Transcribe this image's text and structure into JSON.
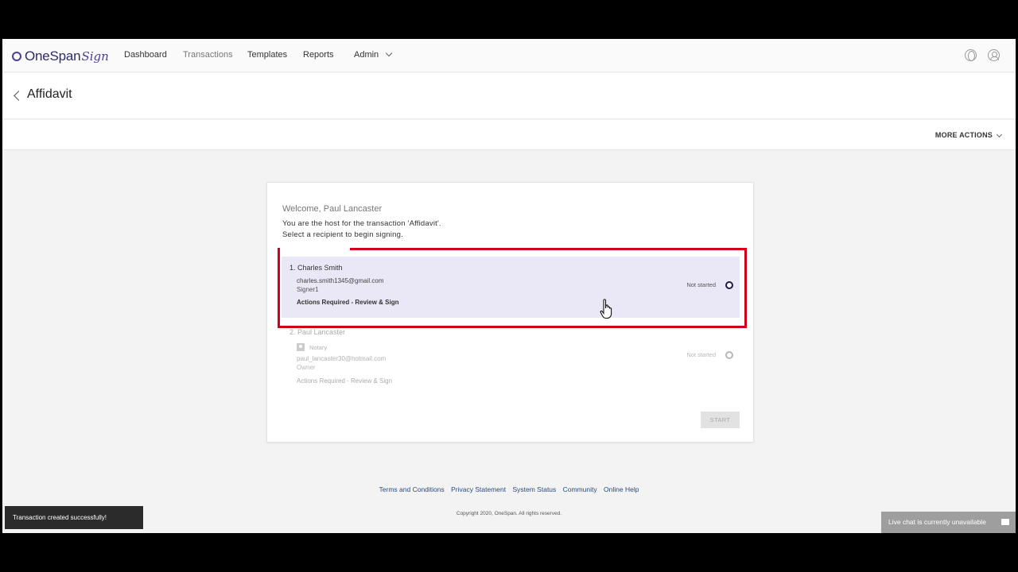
{
  "app": {
    "logo_text": "OneSpan",
    "logo_script": "Sign"
  },
  "nav": {
    "items": [
      {
        "label": "Dashboard"
      },
      {
        "label": "Transactions"
      },
      {
        "label": "Templates"
      },
      {
        "label": "Reports"
      },
      {
        "label": "Admin"
      }
    ],
    "icons": [
      "globe-icon",
      "user-icon"
    ]
  },
  "page": {
    "title": "Affidavit",
    "more_actions": "MORE ACTIONS"
  },
  "card": {
    "welcome": "Welcome, Paul Lancaster",
    "host_line": "You are the host for the transaction 'Affidavit'.",
    "select_line": "Select a recipient to begin signing.",
    "recipients": [
      {
        "name": "1. Charles Smith",
        "email": "charles.smith1345@gmail.com",
        "role": "Signer1",
        "actions": "Actions Required - Review & Sign",
        "status": "Not started"
      },
      {
        "name": "2. Paul Lancaster",
        "tag": "Notary",
        "email": "paul_lancaster30@hotmail.com",
        "role": "Owner",
        "actions": "Actions Required - Review & Sign",
        "status": "Not started"
      }
    ],
    "start_label": "START"
  },
  "footer": {
    "links": [
      "Terms and Conditions",
      "Privacy Statement",
      "System Status",
      "Community",
      "Online Help"
    ],
    "copyright": "Copyright 2020, OneSpan. All rights reserved."
  },
  "toast": "Transaction created successfully!",
  "livechat": "Live chat is currently unavailable",
  "colors": {
    "brand": "#4a3f9a",
    "highlight": "#d0021b",
    "selected_row": "#eae8f6"
  }
}
